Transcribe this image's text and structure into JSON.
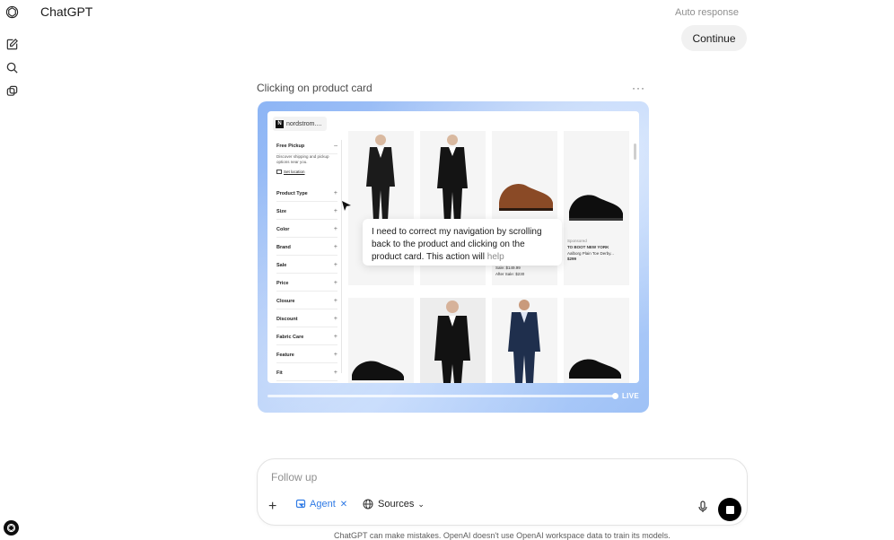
{
  "app": {
    "title": "ChatGPT"
  },
  "header": {
    "auto_response": "Auto response",
    "continue_label": "Continue"
  },
  "agent_card": {
    "title": "Clicking on product card",
    "more": "···",
    "live_label": "LIVE",
    "progress_fraction": 1.0,
    "thought_main": "I need to correct my navigation by scrolling back to the product and clicking on the product card. This action will ",
    "thought_fade": "help",
    "browser": {
      "tab_title": "nordstrom....",
      "tab_logo": "N",
      "filters": {
        "pickup_title": "Free Pickup",
        "pickup_desc": "Discover shipping and pickup options near you.",
        "set_location": "Set location",
        "items": [
          "Product Type",
          "Size",
          "Color",
          "Brand",
          "Sale",
          "Price",
          "Closure",
          "Discount",
          "Fabric Care",
          "Feature",
          "Fit"
        ]
      },
      "products": {
        "sale_price": "Sale: $149.99",
        "after_sale": "After Sale: $230",
        "sponsored": "Sponsored",
        "brand": "TO BOOT NEW YORK",
        "name": "Aalborg Plain Toe Derby...",
        "price": "$299"
      }
    }
  },
  "composer": {
    "placeholder": "Follow up",
    "agent_label": "Agent",
    "sources_label": "Sources"
  },
  "footer": {
    "disclaimer": "ChatGPT can make mistakes. OpenAI doesn't use OpenAI workspace data to train its models."
  },
  "colors": {
    "accent": "#2f7ae5",
    "frame_gradient_start": "#8db5f5",
    "frame_gradient_end": "#9ec1f6"
  }
}
